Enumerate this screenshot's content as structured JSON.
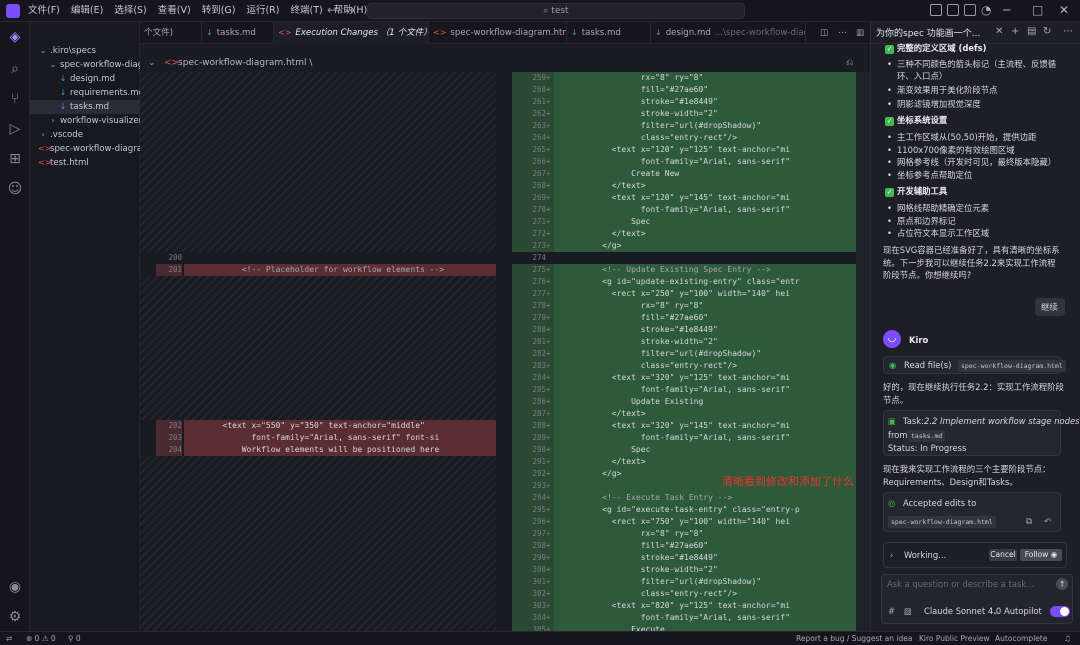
{
  "menu": [
    "文件(F)",
    "编辑(E)",
    "选择(S)",
    "查看(V)",
    "转到(G)",
    "运行(R)",
    "终端(T)",
    "帮助(H)"
  ],
  "search": {
    "text": "test"
  },
  "sidebar": {
    "items": [
      {
        "label": ".kiro\\specs",
        "kind": "folder",
        "chevron": "⌄",
        "indent": 0
      },
      {
        "label": "spec-workflow-diagr...",
        "kind": "folder",
        "chevron": "⌄",
        "indent": 1
      },
      {
        "label": "design.md",
        "kind": "md",
        "indent": 2
      },
      {
        "label": "requirements.md",
        "kind": "md",
        "indent": 2
      },
      {
        "label": "tasks.md",
        "kind": "md",
        "indent": 2,
        "selected": true
      },
      {
        "label": "workflow-visualizer",
        "kind": "folder",
        "chevron": "›",
        "indent": 1
      },
      {
        "label": ".vscode",
        "kind": "folder",
        "chevron": "›",
        "indent": 0
      },
      {
        "label": "spec-workflow-diagra...",
        "kind": "html",
        "indent": 0
      },
      {
        "label": "test.html",
        "kind": "html",
        "indent": 0
      }
    ]
  },
  "tabs": [
    {
      "label": "个文件)"
    },
    {
      "label": "tasks.md"
    },
    {
      "label": "Execution Changes （1 个文件）",
      "active": true
    },
    {
      "label": "spec-workflow-diagram.html"
    },
    {
      "label": "tasks.md"
    },
    {
      "label": "design.md",
      "suffix": "...\\spec-workflow-diagram"
    }
  ],
  "breadcrumb": "spec-workflow-diagram.html \\",
  "diff": {
    "left": [
      {
        "n": "200",
        "text": "",
        "type": "normal",
        "row": 15
      },
      {
        "n": "201",
        "text": "            <!-- Placeholder for workflow elements -->",
        "type": "del",
        "row": 16
      },
      {
        "n": "202",
        "text": "        <text x=\"550\" y=\"350\" text-anchor=\"middle\"",
        "type": "del",
        "row": 29
      },
      {
        "n": "203",
        "text": "              font-family=\"Arial, sans-serif\" font-si",
        "type": "del",
        "row": 30
      },
      {
        "n": "204",
        "text": "            Workflow elements will be positioned here",
        "type": "del",
        "row": 31
      }
    ],
    "right": [
      {
        "n": "259",
        "text": "                  rx=\"8\" ry=\"8\""
      },
      {
        "n": "260",
        "text": "                  fill=\"#27ae60\""
      },
      {
        "n": "261",
        "text": "                  stroke=\"#1e8449\""
      },
      {
        "n": "262",
        "text": "                  stroke-width=\"2\""
      },
      {
        "n": "263",
        "text": "                  filter=\"url(#dropShadow)\""
      },
      {
        "n": "264",
        "text": "                  class=\"entry-rect\"/>"
      },
      {
        "n": "265",
        "text": "            <text x=\"120\" y=\"125\" text-anchor=\"mi"
      },
      {
        "n": "266",
        "text": "                  font-family=\"Arial, sans-serif\""
      },
      {
        "n": "267",
        "text": "                Create New"
      },
      {
        "n": "268",
        "text": "            </text>"
      },
      {
        "n": "269",
        "text": "            <text x=\"120\" y=\"145\" text-anchor=\"mi"
      },
      {
        "n": "270",
        "text": "                  font-family=\"Arial, sans-serif\""
      },
      {
        "n": "271",
        "text": "                Spec"
      },
      {
        "n": "272",
        "text": "            </text>"
      },
      {
        "n": "273",
        "text": "          </g>"
      },
      {
        "n": "274",
        "text": ""
      },
      {
        "n": "275",
        "text": "          <!-- Update Existing Spec Entry -->"
      },
      {
        "n": "276",
        "text": "          <g id=\"update-existing-entry\" class=\"entr"
      },
      {
        "n": "277",
        "text": "            <rect x=\"250\" y=\"100\" width=\"140\" hei"
      },
      {
        "n": "278",
        "text": "                  rx=\"8\" ry=\"8\""
      },
      {
        "n": "279",
        "text": "                  fill=\"#27ae60\""
      },
      {
        "n": "280",
        "text": "                  stroke=\"#1e8449\""
      },
      {
        "n": "281",
        "text": "                  stroke-width=\"2\""
      },
      {
        "n": "282",
        "text": "                  filter=\"url(#dropShadow)\""
      },
      {
        "n": "283",
        "text": "                  class=\"entry-rect\"/>"
      },
      {
        "n": "284",
        "text": "            <text x=\"320\" y=\"125\" text-anchor=\"mi"
      },
      {
        "n": "285",
        "text": "                  font-family=\"Arial, sans-serif\""
      },
      {
        "n": "286",
        "text": "                Update Existing"
      },
      {
        "n": "287",
        "text": "            </text>"
      },
      {
        "n": "288",
        "text": "            <text x=\"320\" y=\"145\" text-anchor=\"mi"
      },
      {
        "n": "289",
        "text": "                  font-family=\"Arial, sans-serif\""
      },
      {
        "n": "290",
        "text": "                Spec"
      },
      {
        "n": "291",
        "text": "            </text>"
      },
      {
        "n": "292",
        "text": "          </g>"
      },
      {
        "n": "293",
        "text": ""
      },
      {
        "n": "294",
        "text": "          <!-- Execute Task Entry -->"
      },
      {
        "n": "295",
        "text": "          <g id=\"execute-task-entry\" class=\"entry-p"
      },
      {
        "n": "296",
        "text": "            <rect x=\"750\" y=\"100\" width=\"140\" hei"
      },
      {
        "n": "297",
        "text": "                  rx=\"8\" ry=\"8\""
      },
      {
        "n": "298",
        "text": "                  fill=\"#27ae60\""
      },
      {
        "n": "299",
        "text": "                  stroke=\"#1e8449\""
      },
      {
        "n": "300",
        "text": "                  stroke-width=\"2\""
      },
      {
        "n": "301",
        "text": "                  filter=\"url(#dropShadow)\""
      },
      {
        "n": "302",
        "text": "                  class=\"entry-rect\"/>"
      },
      {
        "n": "303",
        "text": "            <text x=\"820\" y=\"125\" text-anchor=\"mi"
      },
      {
        "n": "304",
        "text": "                  font-family=\"Arial, sans-serif\""
      },
      {
        "n": "305",
        "text": "                Execute"
      }
    ],
    "normal_right_rows": [
      15
    ]
  },
  "annotation": "清晰看到修改和添加了什么",
  "chat": {
    "tab_title": "为你的spec 功能画一个...",
    "section1_title": "完整的定义区域 (defs)",
    "section1_items": [
      "三种不同颜色的箭头标记（主流程、反馈循",
      "环、入口点）",
      "渐变效果用于美化阶段节点",
      "阴影滤镜增加视觉深度"
    ],
    "section2_title": "坐标系统设置",
    "section2_items": [
      "主工作区域从(50,50)开始，提供边距",
      "1100x700像素的有效绘图区域",
      "网格参考线（开发时可见，最终版本隐藏）",
      "坐标参考点帮助定位"
    ],
    "section3_title": "开发辅助工具",
    "section3_items": [
      "网格线帮助精确定位元素",
      "原点和边界标记",
      "占位符文本显示工作区域"
    ],
    "summary_lines": [
      "现在SVG容器已经准备好了，具有清晰的坐标系",
      "统。下一步我可以继续任务2.2来实现工作流程",
      "阶段节点。你想继续吗?"
    ],
    "user_reply": "继续",
    "agent_name": "Kiro",
    "read_files_label": "Read file(s)",
    "read_file_chip": "spec-workflow-diagram.html",
    "continue_lines": [
      "好的，现在继续执行任务2.2：实现工作流程阶段",
      "节点。"
    ],
    "task_label": "Task:",
    "task_title": "2.2 Implement workflow stage nodes",
    "task_from": "from",
    "task_file": "tasks.md",
    "task_status": "Status: In Progress",
    "impl_lines": [
      "现在我来实现工作流程的三个主要阶段节点：",
      "Requirements、Design和Tasks。"
    ],
    "accepted_label": "Accepted edits to",
    "accepted_file": "spec-workflow-diagram.html",
    "working_label": "Working...",
    "cancel_label": "Cancel",
    "follow_label": "Follow",
    "input_placeholder": "Ask a question or describe a task...",
    "model_label": "Claude Sonnet 4.0",
    "autopilot_label": "Autopilot"
  },
  "status": {
    "left": "⊗ 0 ⚠ 0",
    "ports": "⚲ 0",
    "report": "Report a bug / Suggest an idea",
    "preview": "Kiro Public Preview",
    "autocomplete": "Autocomplete"
  }
}
